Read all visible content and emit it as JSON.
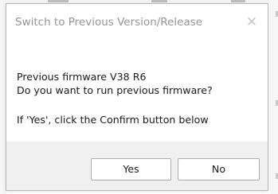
{
  "dialog": {
    "title": "Switch to Previous Version/Release",
    "close_glyph": "✕",
    "message_lines": [
      "Previous firmware V38 R6",
      "Do you want to run previous firmware?",
      "If 'Yes', click the Confirm button below"
    ],
    "buttons": {
      "yes_label": "Yes",
      "no_label": "No"
    }
  },
  "colors": {
    "title_text": "#959595",
    "body_text": "#1a1a1a",
    "footer_bg": "#f0f0f0",
    "button_border": "#adadad"
  },
  "icons": {
    "close": "close-icon"
  }
}
